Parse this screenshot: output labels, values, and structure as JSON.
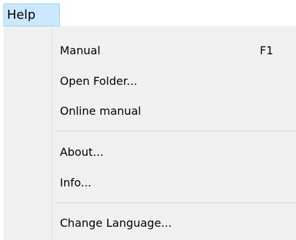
{
  "menubar": {
    "help_label": "Help"
  },
  "help_menu": {
    "items": [
      {
        "label": "Manual",
        "shortcut": "F1"
      },
      {
        "label": "Open Folder...",
        "shortcut": ""
      },
      {
        "label": "Online manual",
        "shortcut": ""
      },
      {
        "label": "About...",
        "shortcut": ""
      },
      {
        "label": "Info...",
        "shortcut": ""
      },
      {
        "label": "Change Language...",
        "shortcut": ""
      }
    ]
  },
  "colors": {
    "menubar_highlight": "#cce8ff",
    "menubar_highlight_border": "#99d1ff",
    "menu_background": "#f0f0f0",
    "separator": "#d7d7d7"
  }
}
